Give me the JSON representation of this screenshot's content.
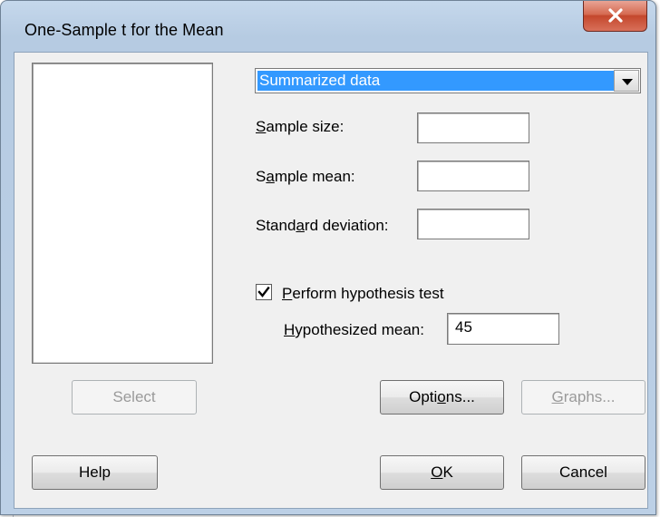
{
  "window": {
    "title": "One-Sample t for the Mean"
  },
  "data_source": {
    "selected": "Summarized data"
  },
  "fields": {
    "sample_size": {
      "label_pre": "",
      "label_u": "S",
      "label_post": "ample size:",
      "value": ""
    },
    "sample_mean": {
      "label_pre": "S",
      "label_u": "a",
      "label_post": "mple mean:",
      "value": ""
    },
    "std_dev": {
      "label_pre": "Stand",
      "label_u": "a",
      "label_post": "rd deviation:",
      "value": ""
    }
  },
  "hypothesis": {
    "checkbox_label_u": "P",
    "checkbox_label_post": "erform hypothesis test",
    "checked": true,
    "mean_label_u": "H",
    "mean_label_post": "ypothesized mean:",
    "mean_value": "45"
  },
  "buttons": {
    "select": "Select",
    "options_pre": "Options",
    "options_u": "",
    "options": "Options...",
    "graphs": "Graphs...",
    "help": "Help",
    "ok_u": "O",
    "ok_post": "K",
    "cancel": "Cancel"
  },
  "icons": {
    "close": "close-icon",
    "dropdown": "chevron-down-icon",
    "check": "check-icon"
  },
  "colors": {
    "selection": "#3399ff",
    "close_button": "#c4472c",
    "frame": "#b6cbe2"
  }
}
